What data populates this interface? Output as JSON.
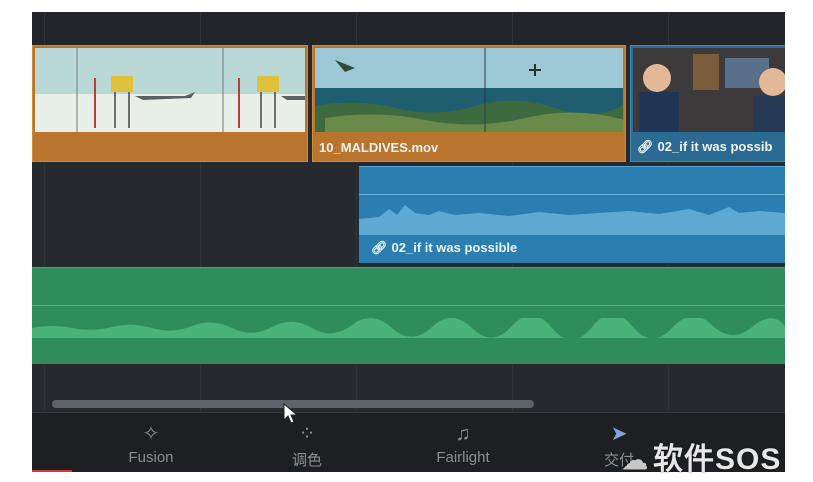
{
  "timeline": {
    "video_clips": [
      {
        "label": ""
      },
      {
        "label": "10_MALDIVES.mov"
      },
      {
        "label": "02_if it was possib",
        "linked": true
      }
    ],
    "audio_clip": {
      "label": "02_if it was possible",
      "linked": true
    },
    "music_clip": {}
  },
  "pages": [
    {
      "label": "Fusion",
      "icon": "fusion-wand-icon"
    },
    {
      "label": "调色",
      "icon": "color-dots-icon"
    },
    {
      "label": "Fairlight",
      "icon": "music-note-icon"
    },
    {
      "label": "交付",
      "icon": "rocket-icon"
    }
  ],
  "watermark": {
    "text": "软件SOS"
  },
  "colors": {
    "video_clip": "#b9742e",
    "audio_clip": "#2b7fb0",
    "music_clip": "#2f8d5b",
    "background": "#26292d",
    "playhead_marker": "#d23a3a"
  }
}
